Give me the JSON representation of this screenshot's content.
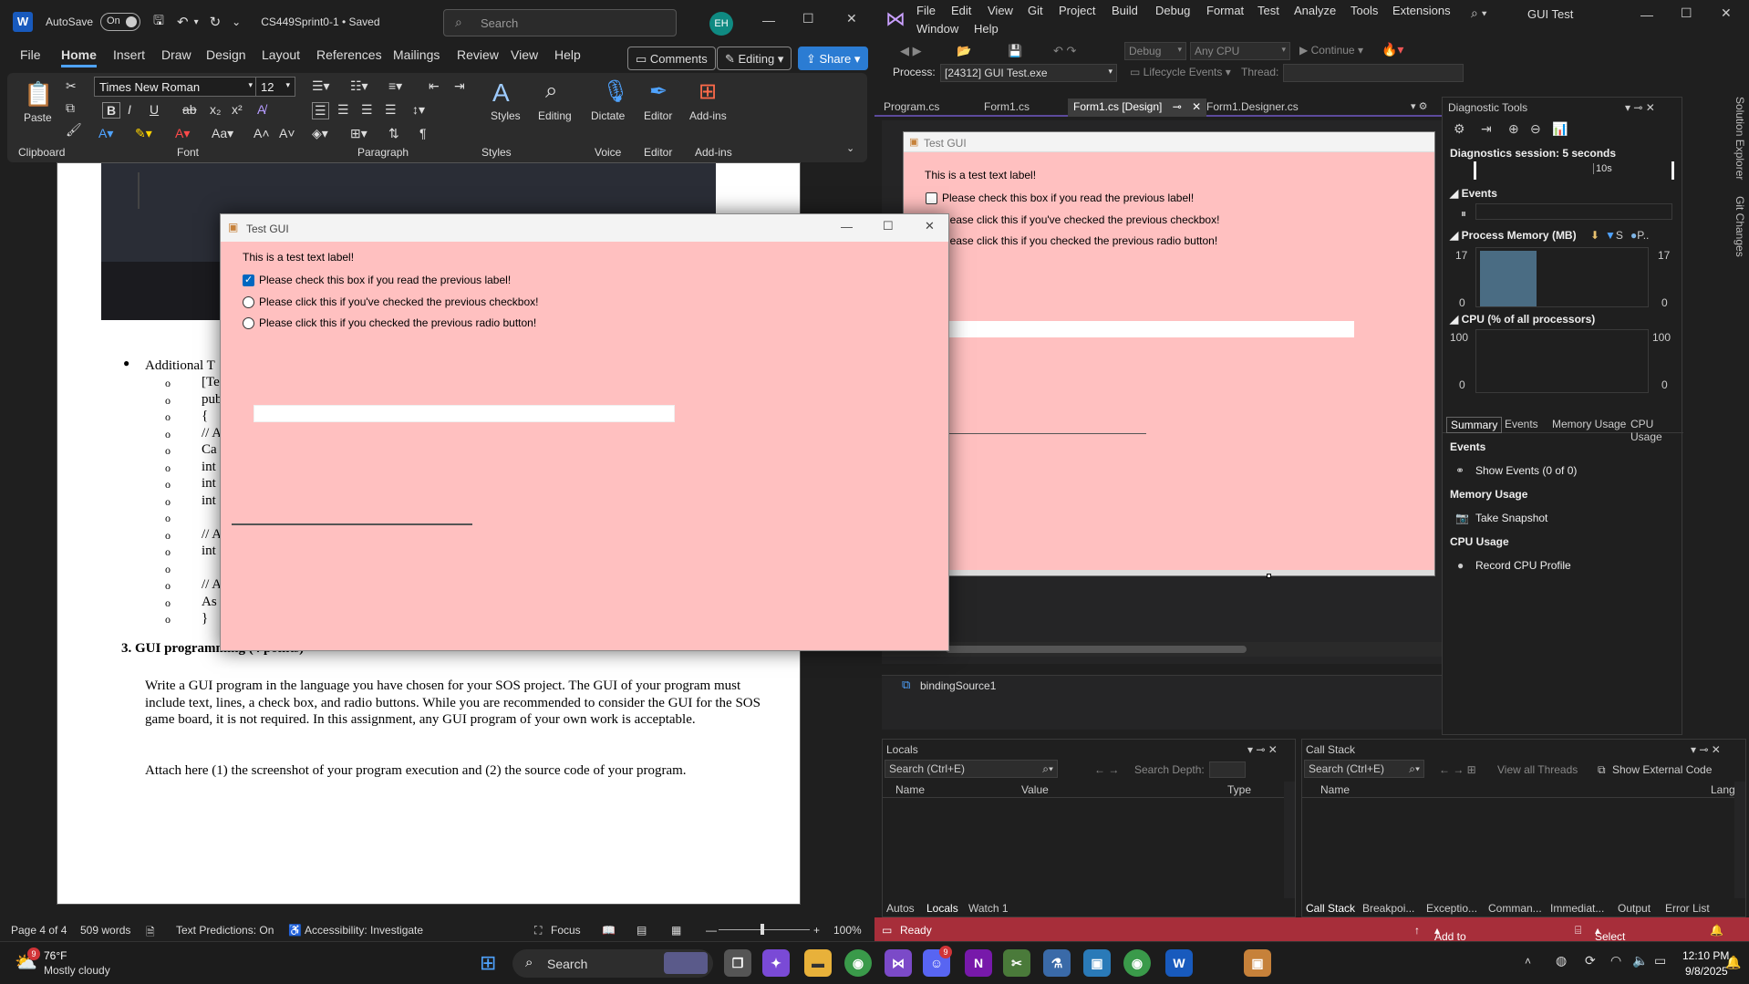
{
  "word": {
    "autosave_label": "AutoSave",
    "autosave_state": "On",
    "doc_title": "CS449Sprint0-1 • Saved",
    "search_placeholder": "Search",
    "avatar": "EH",
    "tabs": [
      "File",
      "Home",
      "Insert",
      "Draw",
      "Design",
      "Layout",
      "References",
      "Mailings",
      "Review",
      "View",
      "Help"
    ],
    "comments": "Comments",
    "editing": "Editing",
    "share": "Share",
    "font_name": "Times New Roman",
    "font_size": "12",
    "groups": {
      "clipboard": "Clipboard",
      "font": "Font",
      "paragraph": "Paragraph",
      "styles": "Styles",
      "voice": "Voice",
      "editor": "Editor",
      "addins": "Add-ins"
    },
    "big_buttons": {
      "paste": "Paste",
      "styles": "Styles",
      "editing": "Editing",
      "dictate": "Dictate",
      "editor": "Editor",
      "addins": "Add-ins"
    },
    "doc": {
      "bullet": "Additional T",
      "sub_items": [
        "[Test]",
        "publi",
        "{",
        "// A",
        "Ca",
        "int",
        "int",
        "int",
        "",
        "// A",
        "int",
        "",
        "// A",
        "As",
        "}"
      ],
      "section_heading": "3.   GUI programming (4 points)",
      "paragraph1": "Write a GUI program in the language you have chosen for your SOS project. The GUI of your program must include text, lines, a check box, and radio buttons.  While you are recommended to consider the GUI for the SOS game board, it is not required. In this assignment, any GUI program of your own work is acceptable.",
      "paragraph2": "Attach here (1) the screenshot of your program execution and (2) the source code of your program."
    },
    "status": {
      "page": "Page 4 of 4",
      "words": "509 words",
      "predictions": "Text Predictions: On",
      "accessibility": "Accessibility: Investigate",
      "focus": "Focus",
      "zoom": "100%"
    }
  },
  "test_gui": {
    "title": "Test GUI",
    "label": "This is a test text label!",
    "checkbox_label": "Please check this box if you read the previous label!",
    "checkbox_checked": true,
    "radio1_label": "Please click this if you've checked the previous checkbox!",
    "radio2_label": "Please click this if you checked the previous radio button!"
  },
  "vs": {
    "menu": [
      "File",
      "Edit",
      "View",
      "Git",
      "Project",
      "Build",
      "Debug",
      "Format",
      "Test",
      "Analyze",
      "Tools",
      "Extensions"
    ],
    "menu_row2": [
      "Window",
      "Help"
    ],
    "solution_title": "GUI Test",
    "config": "Debug",
    "platform": "Any CPU",
    "continue": "Continue",
    "process_label": "Process:",
    "process_value": "[24312] GUI Test.exe",
    "lifecycle": "Lifecycle Events",
    "thread_label": "Thread:",
    "doc_tabs": [
      "Program.cs",
      "Form1.cs",
      "Form1.cs [Design]",
      "Form1.Designer.cs"
    ],
    "designer": {
      "title": "Test GUI",
      "label": "This is a test text label!",
      "checkbox_label": "Please check this box if you read the previous label!",
      "radio1_label": "lease click this if you've checked the previous checkbox!",
      "radio2_label": "lease click this if you checked the previous radio button!",
      "component": "bindingSource1"
    },
    "diagnostics": {
      "title": "Diagnostic Tools",
      "session": "Diagnostics session: 5 seconds",
      "timeline_label": "10s",
      "events": "Events",
      "memory": "Process Memory (MB)",
      "memory_legend_s": "S",
      "memory_legend_p": "P..",
      "memory_max": "17",
      "memory_min": "0",
      "memory_level": 0.95,
      "cpu": "CPU (% of all processors)",
      "cpu_max": "100",
      "cpu_min": "0",
      "tabs": [
        "Summary",
        "Events",
        "Memory Usage",
        "CPU Usage"
      ],
      "sec_events": "Events",
      "show_events": "Show Events (0 of 0)",
      "sec_memory": "Memory Usage",
      "take_snapshot": "Take Snapshot",
      "sec_cpu": "CPU Usage",
      "record_cpu": "Record CPU Profile"
    },
    "side_tabs": [
      "Solution Explorer",
      "Git Changes"
    ],
    "locals": {
      "title": "Locals",
      "search": "Search (Ctrl+E)",
      "depth": "Search Depth:",
      "cols": [
        "Name",
        "Value",
        "Type"
      ],
      "tabs": [
        "Autos",
        "Locals",
        "Watch 1"
      ]
    },
    "callstack": {
      "title": "Call Stack",
      "search": "Search (Ctrl+E)",
      "view_threads": "View all Threads",
      "external": "Show External Code",
      "cols": [
        "Name",
        "Lang"
      ],
      "tabs": [
        "Call Stack",
        "Breakpoi...",
        "Exceptio...",
        "Comman...",
        "Immediat...",
        "Output",
        "Error List"
      ]
    },
    "status": {
      "ready": "Ready",
      "source_control": "Add to Source Control",
      "repo": "Select Repository"
    }
  },
  "taskbar": {
    "weather_temp": "76°F",
    "weather_desc": "Mostly cloudy",
    "weather_badge": "9",
    "search": "Search",
    "discord_badge": "9",
    "time": "12:10 PM",
    "date": "9/8/2025"
  },
  "colors": {
    "form_bg": "#ffc0c0",
    "vs_status": "#a72e3a",
    "word_accent": "#185abd",
    "share": "#2b7cd3"
  }
}
